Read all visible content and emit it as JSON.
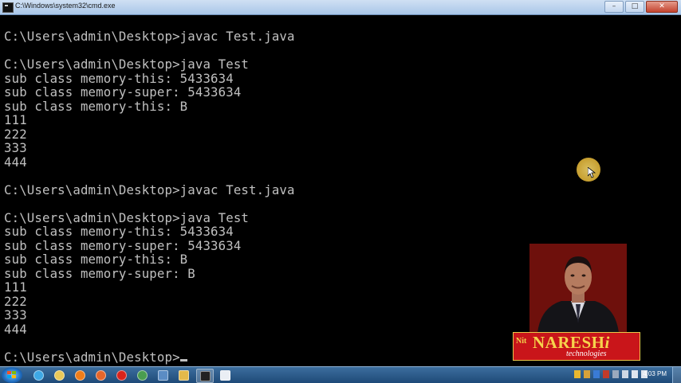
{
  "window": {
    "title": "C:\\Windows\\system32\\cmd.exe",
    "buttons": {
      "minimize": "–",
      "maximize": "□",
      "close": "✕"
    }
  },
  "console": {
    "lines": [
      "C:\\Users\\admin\\Desktop>javac Test.java",
      "",
      "C:\\Users\\admin\\Desktop>java Test",
      "sub class memory-this: 5433634",
      "sub class memory-super: 5433634",
      "sub class memory-this: B",
      "111",
      "222",
      "333",
      "444",
      "",
      "C:\\Users\\admin\\Desktop>javac Test.java",
      "",
      "C:\\Users\\admin\\Desktop>java Test",
      "sub class memory-this: 5433634",
      "sub class memory-super: 5433634",
      "sub class memory-this: B",
      "sub class memory-super: B",
      "111",
      "222",
      "333",
      "444",
      "",
      "C:\\Users\\admin\\Desktop>"
    ]
  },
  "logo": {
    "brand": "NARESH",
    "brand_suffix": "i",
    "subtitle": "technologies",
    "mark": "Nit"
  },
  "taskbar": {
    "apps": [
      "ie-icon",
      "explorer-icon",
      "media-icon",
      "firefox-icon",
      "opera-icon",
      "chrome-icon",
      "network-icon",
      "folder-icon",
      "cmd-icon",
      "document-icon"
    ],
    "active_app": "cmd-icon",
    "clock": "4:03 PM"
  },
  "colors": {
    "console_bg": "#000000",
    "console_text": "#c0c0c0",
    "logo_bg": "#c9151a",
    "logo_text": "#f6d34c",
    "taskbar": "#1e4a78"
  }
}
